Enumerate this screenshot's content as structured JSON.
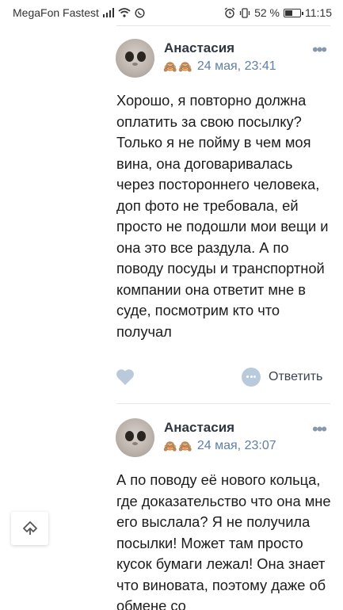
{
  "status_bar": {
    "carrier": "MegaFon Fastest",
    "battery_percent": "52 %",
    "battery_level": 0.52,
    "time": "11:15"
  },
  "comments": [
    {
      "author": "Анастасия",
      "emoji": "🙈🙈",
      "date": "24 мая, 23:41",
      "text": "Хорошо, я повторно должна оплатить за свою посылку? Только я не пойму в чем моя вина, она договаривалась через постороннего человека, доп фото не требовала, ей просто не подошли мои вещи и она это все раздула. А по поводу посуды и транспортной компании она ответит мне в суде, посмотрим кто что получал",
      "reply_label": "Ответить"
    },
    {
      "author": "Анастасия",
      "emoji": "🙈🙈",
      "date": "24 мая, 23:07",
      "text": "А по поводу её нового кольца, где доказательство что она мне его выслала? Я не получила посылки! Может там просто кусок бумаги лежал! Она знает что виновата, поэтому даже об обмене со"
    }
  ],
  "more_glyph": "•••",
  "colors": {
    "author": "#2f3744",
    "date": "#5f7ea8",
    "like_icon": "#b8cadb",
    "divider": "#e3e4e8"
  }
}
